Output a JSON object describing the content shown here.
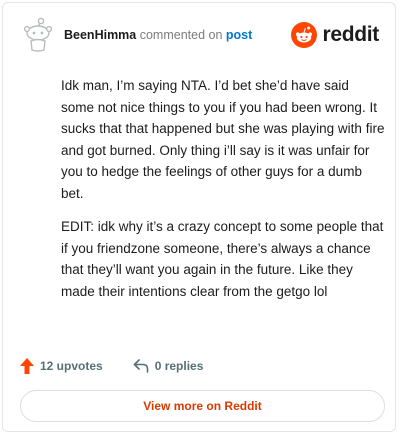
{
  "comment": {
    "author": "BeenHimma",
    "action_text": "commented on",
    "target_link": "post",
    "paragraphs": [
      "Idk man, I’m saying NTA. I’d bet she’d have said some not nice things to you if you had been wrong. It sucks that that happened but she was playing with fire and got burned. Only thing i’ll say is it was unfair for you to hedge the feelings of other guys for a dumb bet.",
      "EDIT: idk why it’s a crazy concept to some people that if you friendzone someone, there’s always a chance that they’ll want you again in the future. Like they made their intentions clear from the getgo lol"
    ]
  },
  "brand": {
    "name": "reddit",
    "icon": "reddit-logo-icon",
    "color": "#ff4500"
  },
  "actions": {
    "upvotes_label": "12 upvotes",
    "upvote_icon": "upvote-arrow-icon",
    "upvote_color": "#ff4500",
    "replies_label": "0 replies",
    "reply_icon": "reply-arrow-icon"
  },
  "footer": {
    "view_more_label": "View more on Reddit",
    "accent": "#d93a00"
  }
}
